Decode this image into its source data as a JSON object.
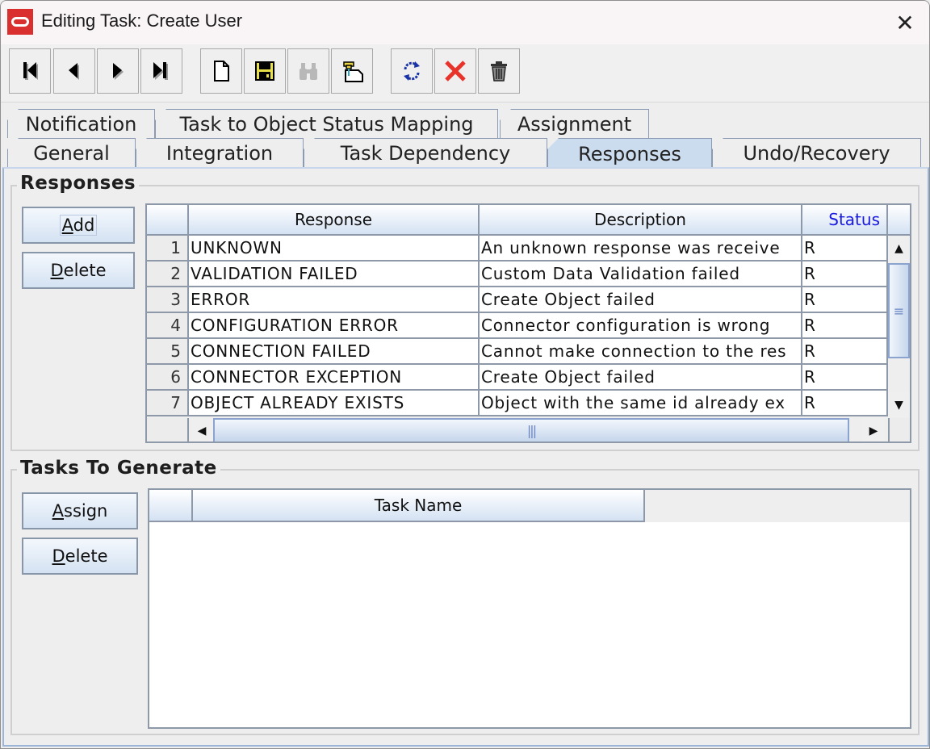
{
  "window": {
    "title": "Editing Task: Create User",
    "close_glyph": "✕"
  },
  "toolbar": {
    "buttons": [
      {
        "name": "first-record",
        "icon": "first-icon",
        "tooltip": ""
      },
      {
        "name": "previous-record",
        "icon": "previous-icon"
      },
      {
        "name": "next-record",
        "icon": "next-icon"
      },
      {
        "name": "last-record",
        "icon": "last-icon"
      },
      {
        "name": "new",
        "icon": "new-document-icon"
      },
      {
        "name": "save",
        "icon": "save-icon"
      },
      {
        "name": "find",
        "icon": "binoculars-icon",
        "disabled": true
      },
      {
        "name": "assign-pin",
        "icon": "pin-document-icon"
      },
      {
        "name": "refresh",
        "icon": "refresh-icon"
      },
      {
        "name": "cancel",
        "icon": "red-x-icon"
      },
      {
        "name": "delete",
        "icon": "trash-icon"
      }
    ]
  },
  "tabs": {
    "row_back": [
      "Notification",
      "Task to Object Status Mapping",
      "Assignment"
    ],
    "row_front": [
      "General",
      "Integration",
      "Task Dependency",
      "Responses",
      "Undo/Recovery"
    ],
    "active": "Responses"
  },
  "responses": {
    "group_title": "Responses",
    "add_label": "Add",
    "delete_label": "Delete",
    "columns": [
      "",
      "Response",
      "Description",
      "Status"
    ],
    "rows": [
      {
        "num": "1",
        "response": "UNKNOWN",
        "description": "An unknown response was receive",
        "status": "R"
      },
      {
        "num": "2",
        "response": "VALIDATION  FAILED",
        "description": "Custom Data Validation failed",
        "status": "R"
      },
      {
        "num": "3",
        "response": "ERROR",
        "description": "Create Object failed",
        "status": "R"
      },
      {
        "num": "4",
        "response": "CONFIGURATION  ERROR",
        "description": "Connector configuration is wrong",
        "status": "R"
      },
      {
        "num": "5",
        "response": "CONNECTION  FAILED",
        "description": "Cannot make connection to the res",
        "status": "R"
      },
      {
        "num": "6",
        "response": "CONNECTOR  EXCEPTION",
        "description": "Create Object failed",
        "status": "R"
      },
      {
        "num": "7",
        "response": "OBJECT  ALREADY  EXISTS",
        "description": "Object with the same id already ex",
        "status": "R"
      }
    ],
    "status_header_color": "#1a1ae0"
  },
  "tasks": {
    "group_title": "Tasks To Generate",
    "assign_label": "Assign",
    "delete_label": "Delete",
    "columns": [
      "",
      "Task Name"
    ],
    "rows": []
  }
}
